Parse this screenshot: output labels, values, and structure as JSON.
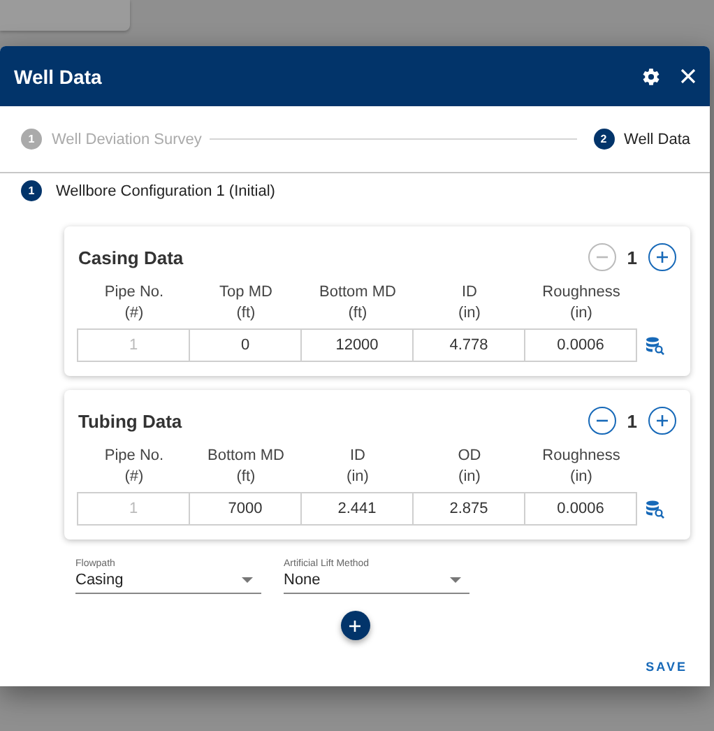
{
  "window": {
    "title": "Well Data"
  },
  "steps": [
    {
      "number": "1",
      "label": "Well Deviation Survey",
      "selected": false
    },
    {
      "number": "2",
      "label": "Well Data",
      "selected": true
    }
  ],
  "configuration": {
    "number": "1",
    "label": "Wellbore Configuration 1 (Initial)"
  },
  "sections": [
    {
      "title": "Casing Data",
      "count": "1",
      "remove_disabled": true,
      "columns": [
        {
          "name": "Pipe No.",
          "unit": "(#)"
        },
        {
          "name": "Top MD",
          "unit": "(ft)"
        },
        {
          "name": "Bottom MD",
          "unit": "(ft)"
        },
        {
          "name": "ID",
          "unit": "(in)"
        },
        {
          "name": "Roughness",
          "unit": "(in)"
        }
      ],
      "rows": [
        [
          {
            "value": "1",
            "disabled": true
          },
          {
            "value": "0",
            "disabled": false
          },
          {
            "value": "12000",
            "disabled": false
          },
          {
            "value": "4.778",
            "disabled": false
          },
          {
            "value": "0.0006",
            "disabled": false
          }
        ]
      ]
    },
    {
      "title": "Tubing Data",
      "count": "1",
      "remove_disabled": false,
      "columns": [
        {
          "name": "Pipe No.",
          "unit": "(#)"
        },
        {
          "name": "Bottom MD",
          "unit": "(ft)"
        },
        {
          "name": "ID",
          "unit": "(in)"
        },
        {
          "name": "OD",
          "unit": "(in)"
        },
        {
          "name": "Roughness",
          "unit": "(in)"
        }
      ],
      "rows": [
        [
          {
            "value": "1",
            "disabled": true
          },
          {
            "value": "7000",
            "disabled": false
          },
          {
            "value": "2.441",
            "disabled": false
          },
          {
            "value": "2.875",
            "disabled": false
          },
          {
            "value": "0.0006",
            "disabled": false
          }
        ]
      ]
    }
  ],
  "fields": [
    {
      "label": "Flowpath",
      "value": "Casing"
    },
    {
      "label": "Artificial Lift Method",
      "value": "None"
    }
  ],
  "save": "SAVE"
}
